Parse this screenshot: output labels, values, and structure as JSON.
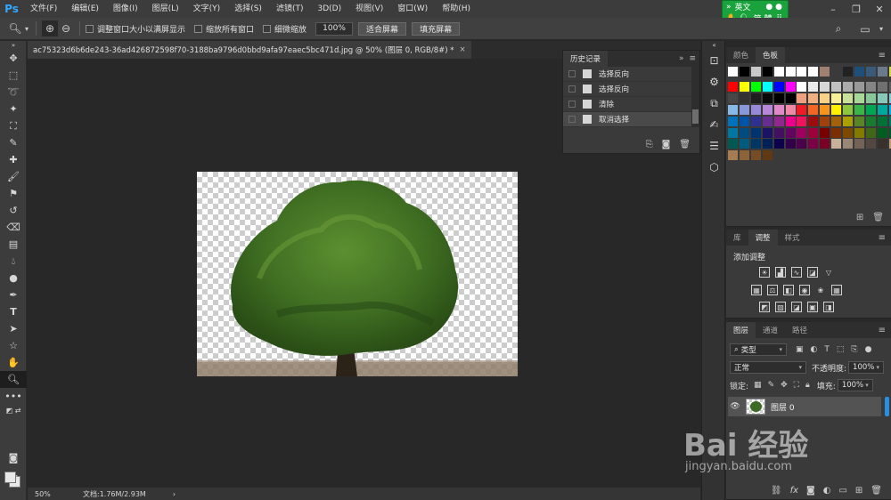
{
  "app": {
    "logo": "Ps",
    "menu": [
      "文件(F)",
      "编辑(E)",
      "图像(I)",
      "图层(L)",
      "文字(Y)",
      "选择(S)",
      "滤镜(T)",
      "3D(D)",
      "视图(V)",
      "窗口(W)",
      "帮助(H)"
    ],
    "window_controls": [
      "minimize-icon",
      "restore-icon",
      "close-icon"
    ],
    "ime": {
      "lang": "英文",
      "mode": "简 體"
    }
  },
  "options": {
    "checkboxes": [
      "调整窗口大小以满屏显示",
      "缩放所有窗口",
      "细微缩放"
    ],
    "zoom_value": "100%",
    "fit_screen": "适合屏幕",
    "fill_screen": "填充屏幕"
  },
  "document": {
    "tab_title": "ac75323d6b6de243-36ad426872598f70-3188ba9796d0bbd9afa97eaec5bc471d.jpg @ 50% (图层 0, RGB/8#) *",
    "tab_close": "×",
    "zoom": "50%",
    "doc_info": "文档:1.76M/2.93M",
    "status_arrow": "›"
  },
  "history": {
    "tab": "历史记录",
    "items": [
      "选择反向",
      "选择反向",
      "清除",
      "取消选择"
    ],
    "selected_index": 3
  },
  "swatches_panel": {
    "tabs": [
      "颜色",
      "色板"
    ],
    "active": "色板",
    "colors": [
      [
        "#ffffff",
        "#000000",
        "#c9c9c9",
        "#000000",
        "#ffffff",
        "#ffffff",
        "#ffffff",
        "#ffffff",
        "#a08070",
        "#3a3a3a",
        "#222222",
        "#1e4e7a",
        "#3a5a7a",
        "#6a7a8a",
        "#d8d84a"
      ],
      [
        "#ff0000",
        "#ffff00",
        "#00ff00",
        "#00ffff",
        "#0000ff",
        "#ff00ff",
        "#ffffff",
        "#ebebeb",
        "#d6d6d6",
        "#c2c2c2",
        "#adadad",
        "#999999",
        "#858585",
        "#707070",
        "#5c5c5c"
      ],
      [
        "#474747",
        "#333333",
        "#1f1f1f",
        "#0a0a0a",
        "#000000",
        "#000000",
        "#f0a080",
        "#f0b080",
        "#f8d088",
        "#f8f098",
        "#c8e098",
        "#a8d898",
        "#88c898",
        "#88c8b8",
        "#88c8d8"
      ],
      [
        "#88b8e8",
        "#8898d8",
        "#9888d8",
        "#b888d8",
        "#e088c8",
        "#f088a8",
        "#ee1c24",
        "#f26522",
        "#f7941d",
        "#fff200",
        "#8dc63f",
        "#39b54a",
        "#00a651",
        "#00a99d",
        "#00aeef"
      ],
      [
        "#0072bc",
        "#0054a6",
        "#2e3192",
        "#662d91",
        "#92278f",
        "#ec008c",
        "#ed145b",
        "#9e0b0f",
        "#a0410d",
        "#a36209",
        "#aba000",
        "#598527",
        "#1a7b30",
        "#007236",
        "#00746b"
      ],
      [
        "#0076a3",
        "#004b80",
        "#003471",
        "#1b1464",
        "#440e62",
        "#630460",
        "#9e005d",
        "#9e0039",
        "#790000",
        "#7b2e00",
        "#7d4900",
        "#827b00",
        "#406618",
        "#005e20",
        "#005826"
      ],
      [
        "#005952",
        "#005b7f",
        "#003663",
        "#002157",
        "#0d004c",
        "#32004b",
        "#4b0049",
        "#7b0046",
        "#7a0026",
        "#c7b299",
        "#998675",
        "#736357",
        "#534741",
        "#37302d",
        "#c69c6d"
      ],
      [
        "#a67c52",
        "#8c6239",
        "#754c24",
        "#603913"
      ]
    ]
  },
  "adjustments": {
    "tabs": [
      "库",
      "调整",
      "样式"
    ],
    "active": "调整",
    "title": "添加调整",
    "row1": [
      "brightness-icon",
      "levels-icon",
      "curves-icon",
      "exposure-icon",
      "vibrance-icon"
    ],
    "row2": [
      "hue-icon",
      "color-balance-icon",
      "bw-icon",
      "photo-filter-icon",
      "channel-mixer-icon",
      "color-lookup-icon"
    ],
    "row3": [
      "invert-icon",
      "posterize-icon",
      "threshold-icon",
      "gradient-map-icon",
      "selective-color-icon"
    ]
  },
  "layers": {
    "tabs": [
      "图层",
      "通道",
      "路径"
    ],
    "active": "图层",
    "filter": "类型",
    "blend_mode": "正常",
    "opacity_label": "不透明度:",
    "opacity_value": "100%",
    "lock_label": "锁定:",
    "fill_label": "填充:",
    "fill_value": "100%",
    "layer_name": "图层 0"
  },
  "watermark": {
    "brand": "Bai 经验",
    "url": "jingyan.baidu.com"
  },
  "colors": {
    "bg": "#282828",
    "panel": "#3a3a3a",
    "menubar": "#3c3c3c",
    "accent_ps": "#31a8ff",
    "ime_green": "#1aa23c"
  }
}
